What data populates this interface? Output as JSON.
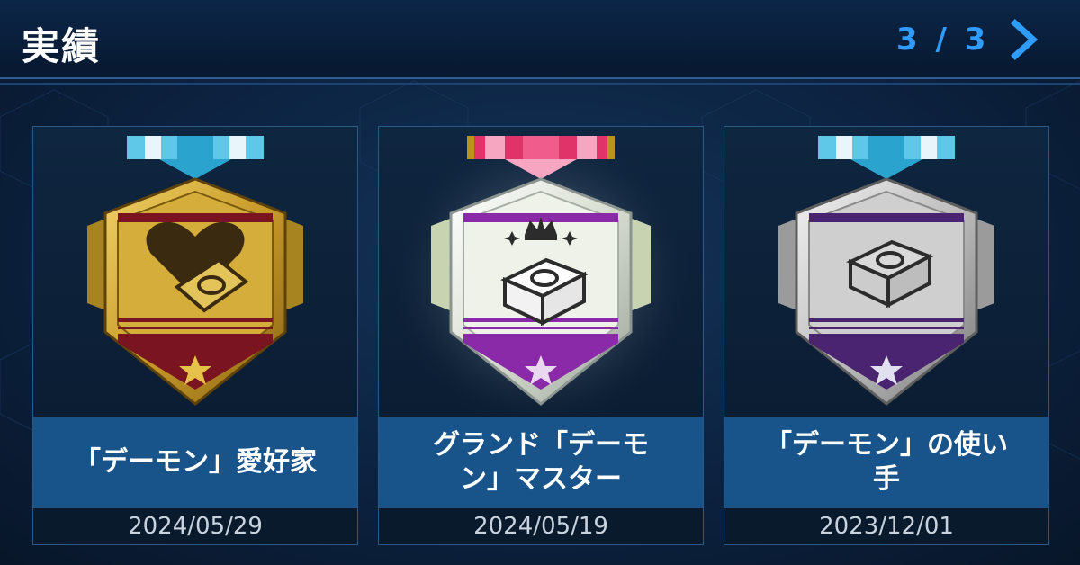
{
  "header": {
    "title": "実績",
    "pager": "3 / 3",
    "next_icon": "chevron-right-icon"
  },
  "achievements": [
    {
      "name": "「デーモン」愛好家",
      "date": "2024/05/29",
      "tier": "gold",
      "icon": "heart-deck-icon",
      "ribbon": "blue"
    },
    {
      "name": "グランド「デーモン」マスター",
      "name_line1": "グランド「デーモ",
      "name_line2": "ン」マスター",
      "date": "2024/05/19",
      "tier": "platinum-purple",
      "icon": "crowned-deck-icon",
      "ribbon": "pink"
    },
    {
      "name": "「デーモン」の使い手",
      "name_line1": "「デーモン」の使い",
      "name_line2": "手",
      "date": "2023/12/01",
      "tier": "silver-purple",
      "icon": "deck-icon",
      "ribbon": "blue"
    }
  ],
  "colors": {
    "accent": "#2f9cff",
    "name_box": "#185489",
    "gold": "#d9b23a",
    "purple": "#8b2aa8",
    "crimson": "#7a1420"
  }
}
